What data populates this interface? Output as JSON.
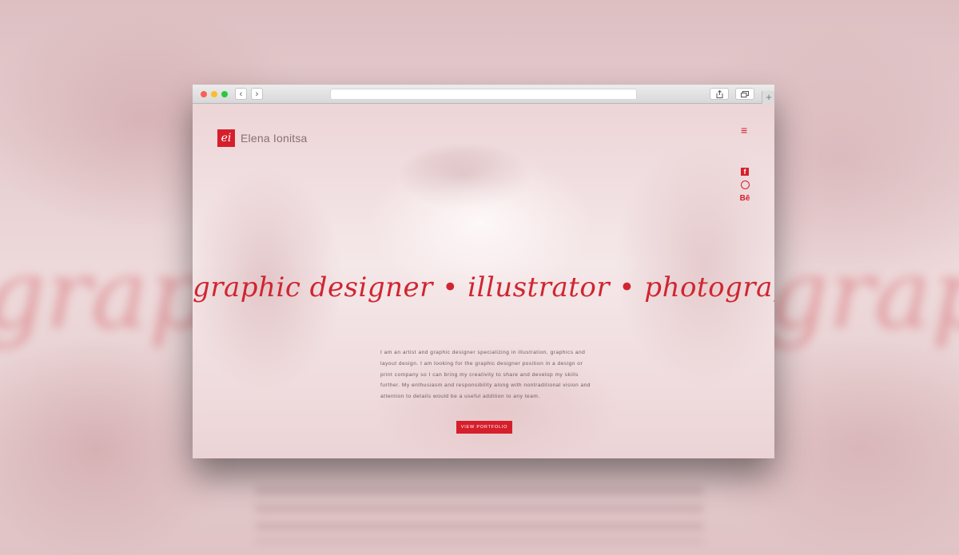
{
  "backdrop": {
    "script_text": "graph"
  },
  "browser": {
    "back_label": "‹",
    "forward_label": "›",
    "new_tab_label": "+"
  },
  "site": {
    "logo_mark": "ei",
    "logo_text": "Elena Ionitsa",
    "menu_icon": "≡",
    "social": {
      "facebook": "f",
      "behance": "Bē"
    },
    "tagline": "graphic designer • illustrator • photographer",
    "bio": "I am an artist and graphic designer specializing in illustration, graphics and layout design. I am looking for the graphic designer position in a design or print company so I can bring my creativity to share and develop my skills further. My enthusiasm and responsibility along with nontraditional vision and attention to details would be a useful addition to any team.",
    "cta_label": "VIEW PORTFOLIO"
  },
  "colors": {
    "accent": "#d61f2c",
    "text": "#6d5d5f"
  }
}
